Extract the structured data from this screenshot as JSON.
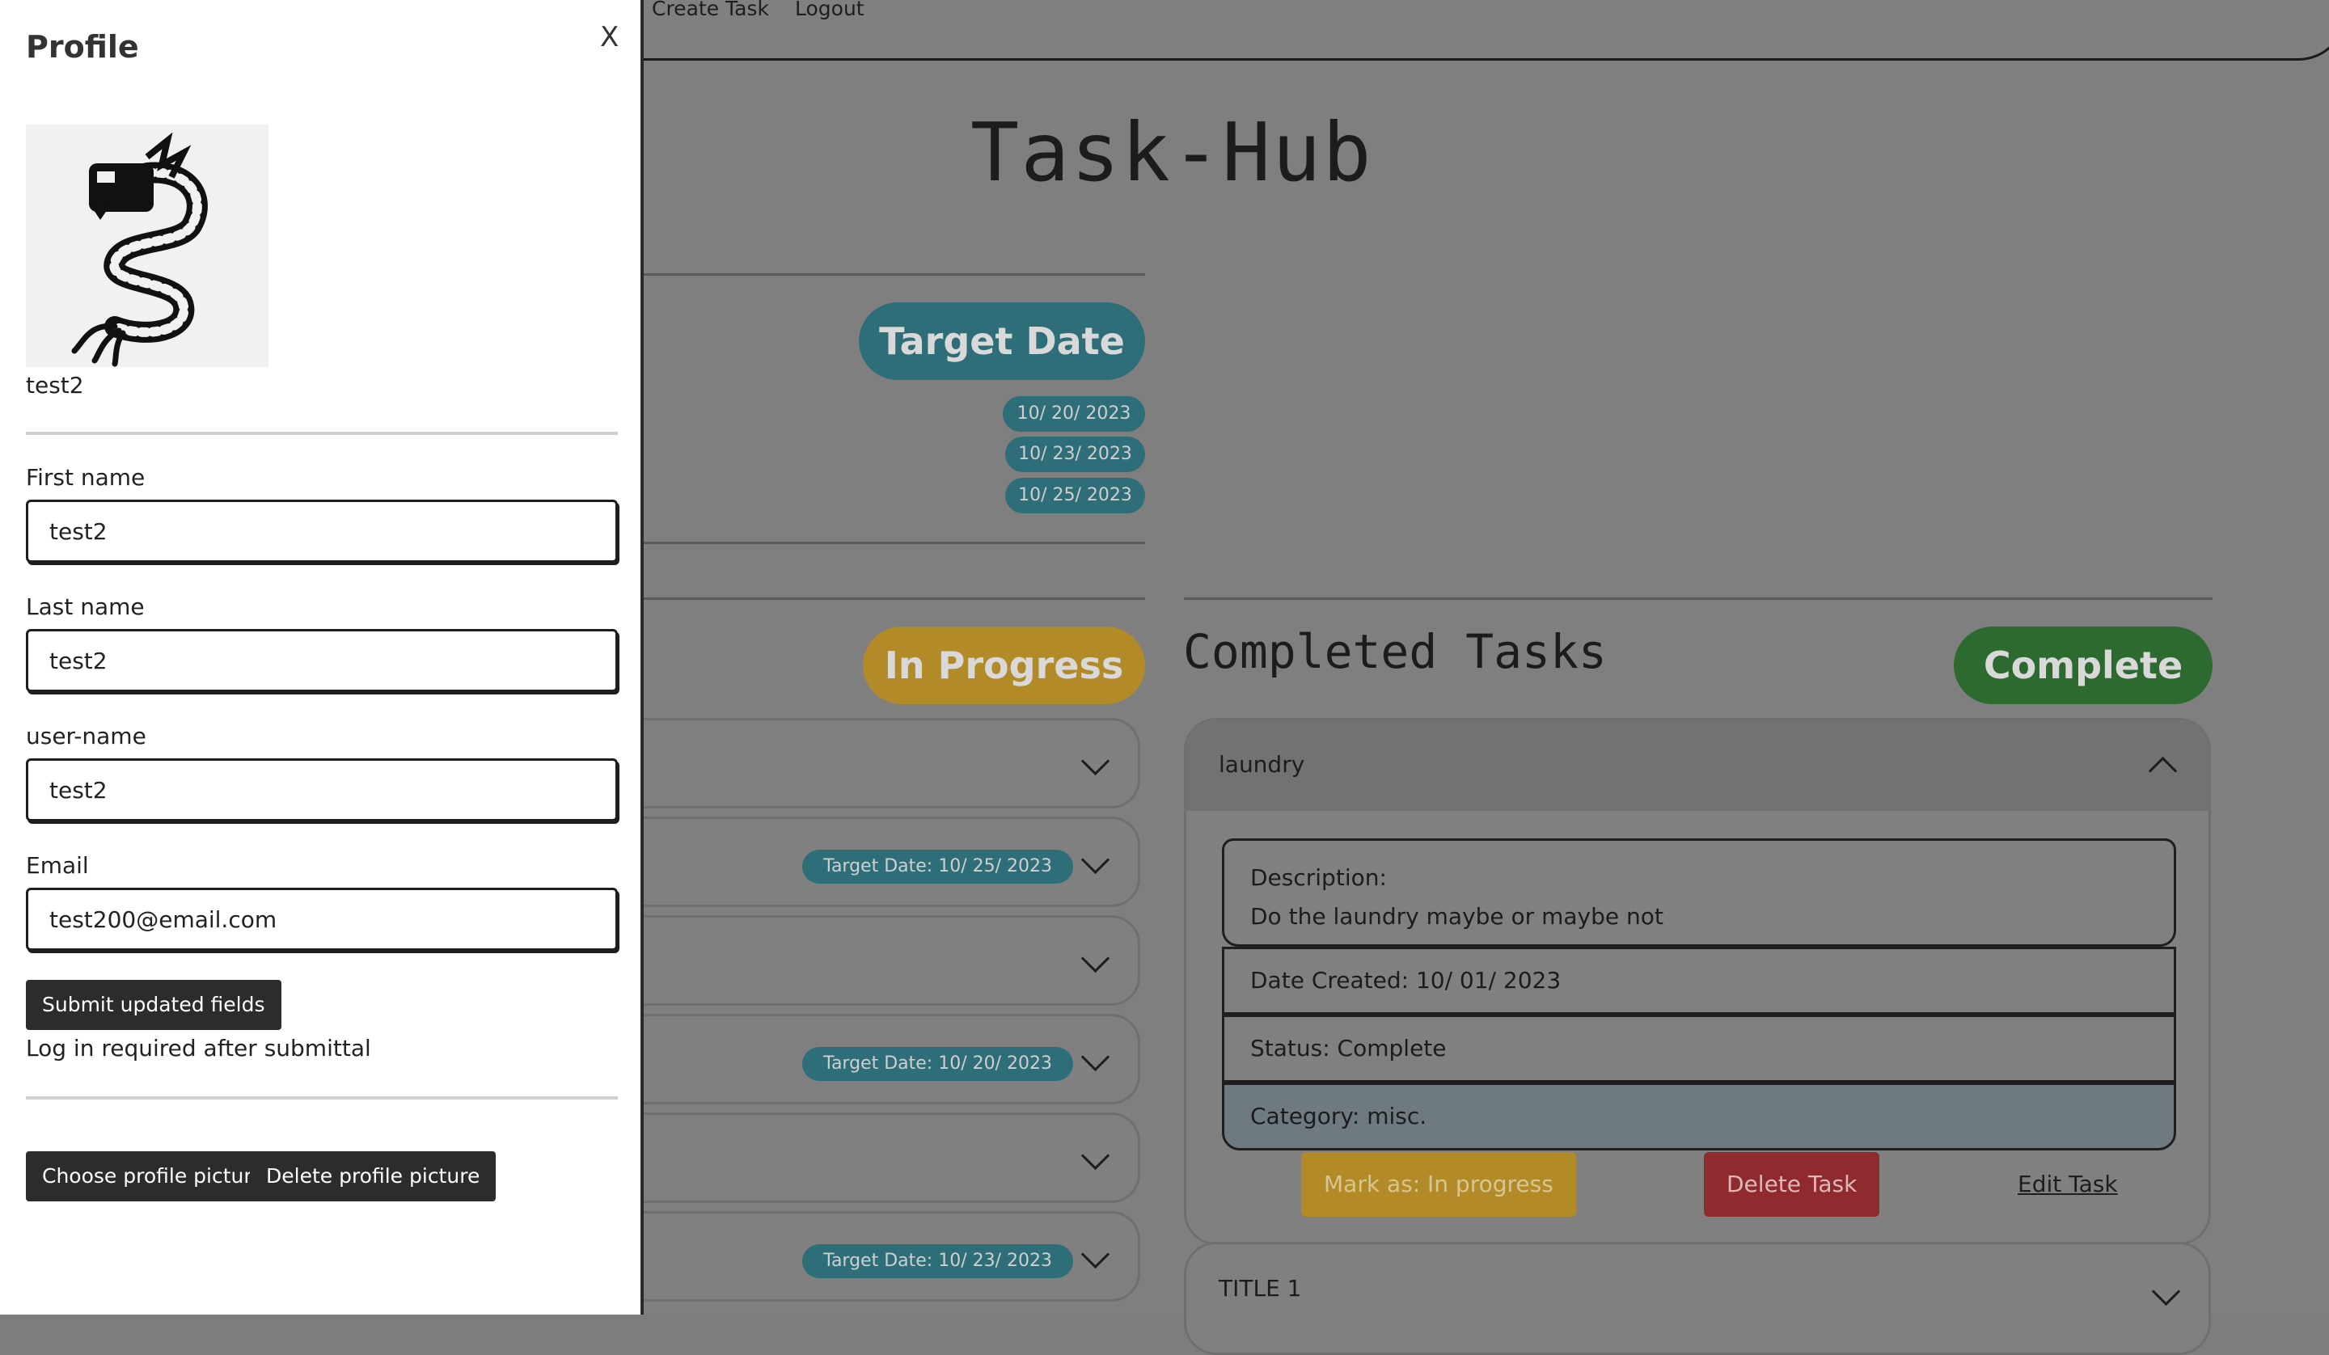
{
  "nav": {
    "create_task": "Create Task",
    "logout": "Logout"
  },
  "app": {
    "title": "Task-Hub"
  },
  "target_section": {
    "pill_label": "Target Date",
    "dates": [
      "10/ 20/ 2023",
      "10/ 23/ 2023",
      "10/ 25/ 2023"
    ]
  },
  "in_progress": {
    "pill_label": "In Progress",
    "cards": [
      {
        "date_label": ""
      },
      {
        "date_label": "Target Date: 10/ 25/ 2023"
      },
      {
        "date_label": ""
      },
      {
        "date_label": "Target Date: 10/ 20/ 2023"
      },
      {
        "date_label": ""
      },
      {
        "date_label": "Target Date: 10/ 23/ 2023"
      }
    ]
  },
  "completed": {
    "heading": "Completed Tasks",
    "pill_label": "Complete",
    "expanded_task": {
      "title": "laundry",
      "description_label": "Description:",
      "description": "Do the laundry maybe or maybe not",
      "date_created": "Date Created: 10/ 01/ 2023",
      "status": "Status: Complete",
      "category": "Category: misc.",
      "mark_in_progress": "Mark as: In progress",
      "delete": "Delete Task",
      "edit": "Edit Task"
    },
    "next_task_title": "TITLE 1"
  },
  "profile": {
    "title": "Profile",
    "close": "X",
    "avatar_icon": "dragon-icon",
    "username_caption": "test2",
    "first_name_label": "First name",
    "first_name_value": "test2",
    "last_name_label": "Last name",
    "last_name_value": "test2",
    "user_name_label": "user-name",
    "user_name_value": "test2",
    "email_label": "Email",
    "email_value": "test200@email.com",
    "submit_label": "Submit updated fields",
    "note": "Log in required after submittal",
    "choose_picture_label": "Choose profile picture",
    "delete_picture_label": "Delete profile picture"
  },
  "colors": {
    "teal": "#2e6e79",
    "yellow": "#b38a28",
    "green": "#2d6a2f",
    "red": "#8f2a2e",
    "dark_button": "#2c2c2c"
  }
}
